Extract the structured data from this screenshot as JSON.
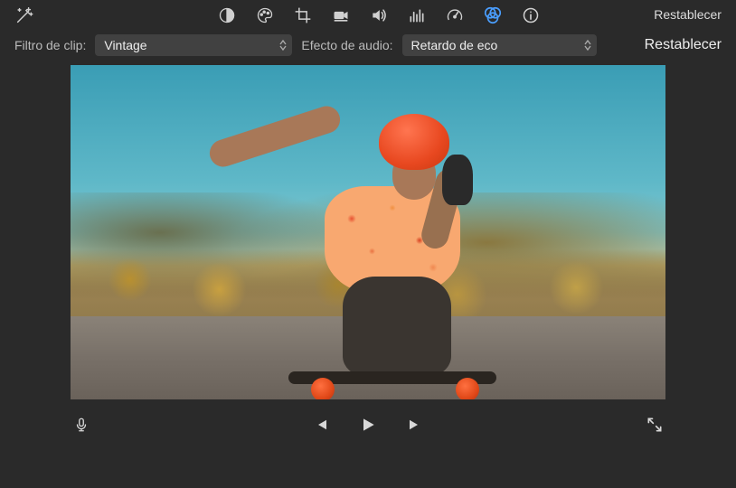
{
  "toolbar": {
    "reset_label": "Restablecer",
    "icons": {
      "magic": "magic-wand-icon",
      "contrast": "contrast-icon",
      "palette": "palette-icon",
      "crop": "crop-icon",
      "camera": "camera-icon",
      "volume": "volume-icon",
      "noise": "equalizer-icon",
      "speed": "speedometer-icon",
      "filter": "filter-icon",
      "info": "info-icon"
    }
  },
  "filters": {
    "clip_label": "Filtro de clip:",
    "clip_value": "Vintage",
    "audio_label": "Efecto de audio:",
    "audio_value": "Retardo de eco",
    "reset_label": "Restablecer"
  },
  "controls": {
    "mic": "microphone-icon",
    "prev": "skip-back-icon",
    "play": "play-icon",
    "next": "skip-forward-icon",
    "fullscreen": "fullscreen-icon"
  },
  "colors": {
    "active": "#4a9eff",
    "accent": "#e84820"
  }
}
